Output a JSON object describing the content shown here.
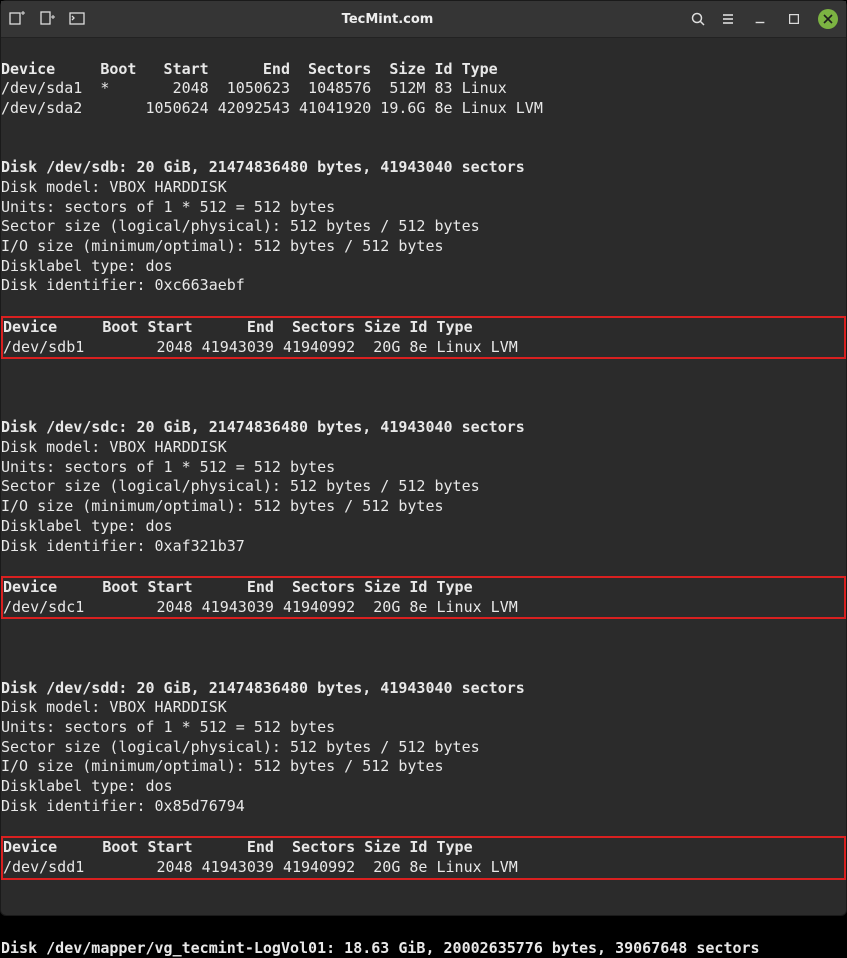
{
  "window": {
    "title": "TecMint.com"
  },
  "sda": {
    "header": "Device     Boot   Start      End  Sectors  Size Id Type",
    "row1": "/dev/sda1  *       2048  1050623  1048576  512M 83 Linux",
    "row2": "/dev/sda2       1050624 42092543 41041920 19.6G 8e Linux LVM"
  },
  "sdb": {
    "title": "Disk /dev/sdb: 20 GiB, 21474836480 bytes, 41943040 sectors",
    "model": "Disk model: VBOX HARDDISK",
    "units": "Units: sectors of 1 * 512 = 512 bytes",
    "sector": "Sector size (logical/physical): 512 bytes / 512 bytes",
    "io": "I/O size (minimum/optimal): 512 bytes / 512 bytes",
    "label": "Disklabel type: dos",
    "ident": "Disk identifier: 0xc663aebf",
    "header": "Device     Boot Start      End  Sectors Size Id Type",
    "row": "/dev/sdb1        2048 41943039 41940992  20G 8e Linux LVM"
  },
  "sdc": {
    "title": "Disk /dev/sdc: 20 GiB, 21474836480 bytes, 41943040 sectors",
    "model": "Disk model: VBOX HARDDISK",
    "units": "Units: sectors of 1 * 512 = 512 bytes",
    "sector": "Sector size (logical/physical): 512 bytes / 512 bytes",
    "io": "I/O size (minimum/optimal): 512 bytes / 512 bytes",
    "label": "Disklabel type: dos",
    "ident": "Disk identifier: 0xaf321b37",
    "header": "Device     Boot Start      End  Sectors Size Id Type",
    "row": "/dev/sdc1        2048 41943039 41940992  20G 8e Linux LVM"
  },
  "sdd": {
    "title": "Disk /dev/sdd: 20 GiB, 21474836480 bytes, 41943040 sectors",
    "model": "Disk model: VBOX HARDDISK",
    "units": "Units: sectors of 1 * 512 = 512 bytes",
    "sector": "Sector size (logical/physical): 512 bytes / 512 bytes",
    "io": "I/O size (minimum/optimal): 512 bytes / 512 bytes",
    "label": "Disklabel type: dos",
    "ident": "Disk identifier: 0x85d76794",
    "header": "Device     Boot Start      End  Sectors Size Id Type",
    "row": "/dev/sdd1        2048 41943039 41940992  20G 8e Linux LVM"
  },
  "mapper": {
    "title": "Disk /dev/mapper/vg_tecmint-LogVol01: 18.63 GiB, 20002635776 bytes, 39067648 sectors"
  }
}
